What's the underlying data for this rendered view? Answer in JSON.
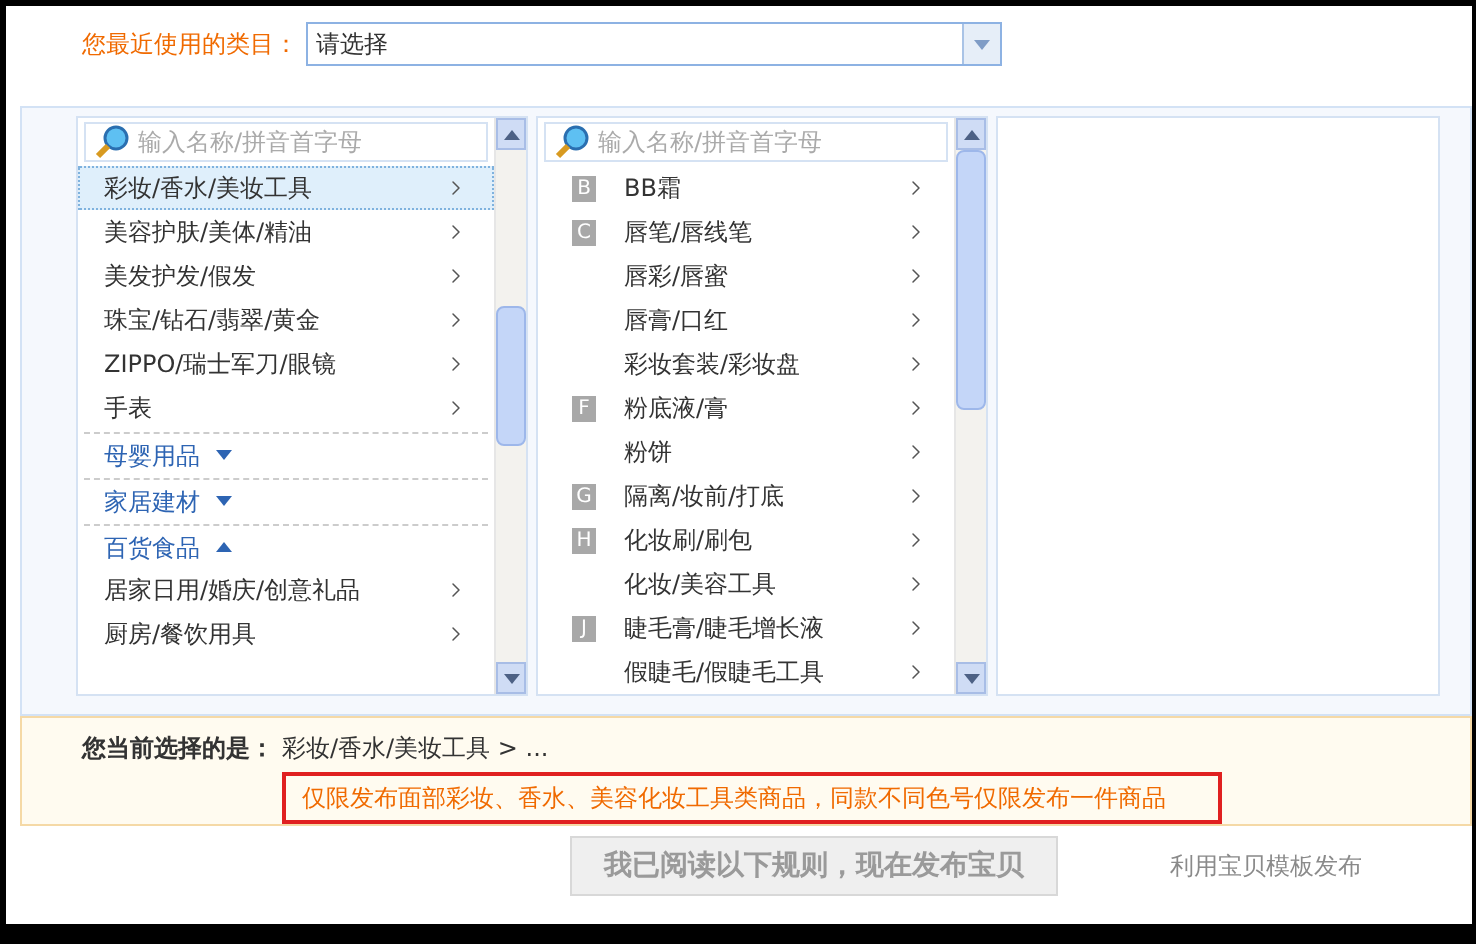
{
  "recent": {
    "label": "您最近使用的类目：",
    "value": "请选择"
  },
  "columns": [
    {
      "search_placeholder": "输入名称/拼音首字母",
      "items": [
        {
          "kind": "item",
          "label": "彩妆/香水/美妆工具",
          "selected": true
        },
        {
          "kind": "item",
          "label": "美容护肤/美体/精油",
          "selected": false
        },
        {
          "kind": "item",
          "label": "美发护发/假发",
          "selected": false
        },
        {
          "kind": "item",
          "label": "珠宝/钻石/翡翠/黄金",
          "selected": false
        },
        {
          "kind": "item",
          "label": "ZIPPO/瑞士军刀/眼镜",
          "selected": false
        },
        {
          "kind": "item",
          "label": "手表",
          "selected": false
        },
        {
          "kind": "group",
          "label": "母婴用品",
          "expanded": false
        },
        {
          "kind": "group",
          "label": "家居建材",
          "expanded": false
        },
        {
          "kind": "group",
          "label": "百货食品",
          "expanded": true
        },
        {
          "kind": "item",
          "label": "居家日用/婚庆/创意礼品",
          "selected": false
        },
        {
          "kind": "item",
          "label": "厨房/餐饮用具",
          "selected": false
        }
      ]
    },
    {
      "search_placeholder": "输入名称/拼音首字母",
      "items": [
        {
          "kind": "item",
          "letter": "B",
          "label": "BB霜",
          "selected": false
        },
        {
          "kind": "item",
          "letter": "C",
          "label": "唇笔/唇线笔",
          "selected": false
        },
        {
          "kind": "item",
          "label": "唇彩/唇蜜",
          "selected": false
        },
        {
          "kind": "item",
          "label": "唇膏/口红",
          "selected": false
        },
        {
          "kind": "item",
          "label": "彩妆套装/彩妆盘",
          "selected": false
        },
        {
          "kind": "item",
          "letter": "F",
          "label": "粉底液/膏",
          "selected": false
        },
        {
          "kind": "item",
          "label": "粉饼",
          "selected": false
        },
        {
          "kind": "item",
          "letter": "G",
          "label": "隔离/妆前/打底",
          "selected": false
        },
        {
          "kind": "item",
          "letter": "H",
          "label": "化妆刷/刷包",
          "selected": false
        },
        {
          "kind": "item",
          "label": "化妆/美容工具",
          "selected": false
        },
        {
          "kind": "item",
          "letter": "J",
          "label": "睫毛膏/睫毛增长液",
          "selected": false
        },
        {
          "kind": "item",
          "label": "假睫毛/假睫毛工具",
          "selected": false
        }
      ]
    }
  ],
  "current": {
    "label": "您当前选择的是：",
    "path": "彩妆/香水/美妆工具 > ..."
  },
  "notice": "仅限发布面部彩妆、香水、美容化妆工具类商品，同款不同色号仅限发布一件商品",
  "publish_button": {
    "label": "我已阅读以下规则，现在发布宝贝",
    "disabled": true
  },
  "template_link": "利用宝贝模板发布"
}
